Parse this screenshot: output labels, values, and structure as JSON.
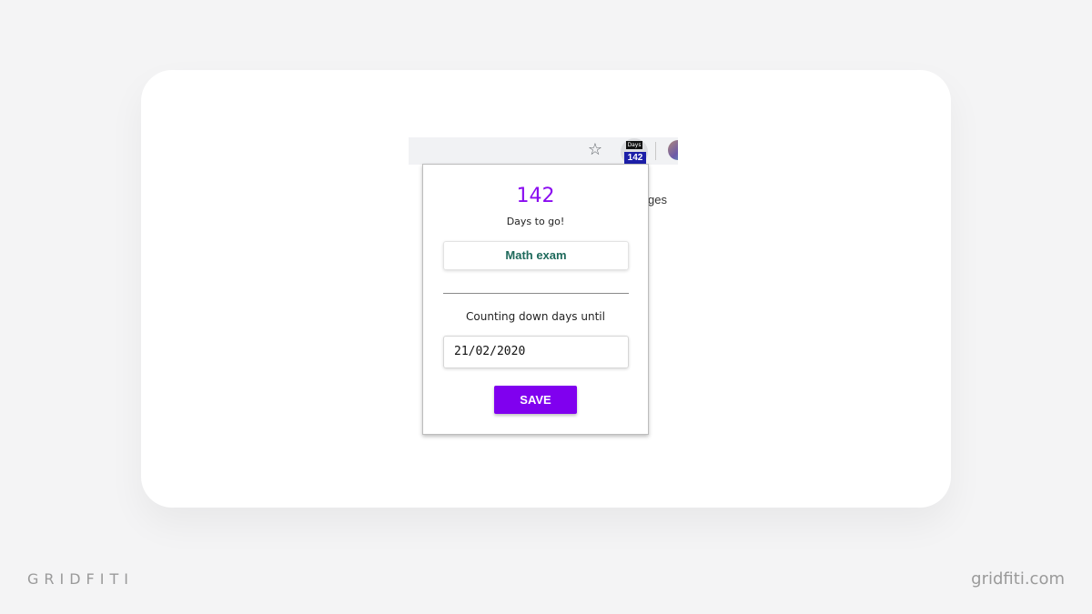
{
  "toolbar": {
    "star_icon": "star-icon",
    "extension": {
      "top_label": "Days",
      "badge": "142"
    }
  },
  "page_background_text": "ges",
  "popup": {
    "count": "142",
    "days_label": "Days to go!",
    "event_name": "Math exam",
    "until_label": "Counting down days until",
    "date_value": "21/02/2020",
    "save_label": "SAVE"
  },
  "branding": {
    "left": "GRIDFITI",
    "right": "gridfiti.com"
  },
  "colors": {
    "accent": "#8000ef",
    "count": "#8a0bf0",
    "event_text": "#1f6a5c",
    "badge": "#1c1fa8"
  }
}
